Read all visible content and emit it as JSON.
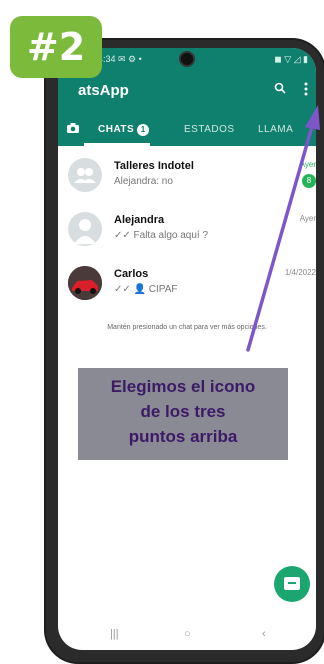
{
  "step_badge": "#2",
  "status_bar": {
    "left": "4:34 ✉ ⚙ •",
    "right": "◼ ▽ ◿ ▮"
  },
  "header": {
    "title": "atsApp",
    "search_icon": "search-icon",
    "menu_icon": "more-vert-icon"
  },
  "tabs": {
    "chats_label": "CHATS",
    "chats_count": "1",
    "estados_label": "ESTADOS",
    "llamadas_label": "LLAMA"
  },
  "chats": [
    {
      "name": "Talleres Indotel",
      "message": "Alejandra: no",
      "time": "Ayer",
      "unread": "8"
    },
    {
      "name": "Alejandra",
      "message": "✓✓ Falta algo aquí ?",
      "time": "Ayer"
    },
    {
      "name": "Carlos",
      "message": "✓✓ 👤 CIPAF",
      "time": "1/4/2022"
    }
  ],
  "hint": "Mantén presionado un chat para ver más opciones.",
  "callout": {
    "line1": "Elegimos el icono",
    "line2": "de los tres",
    "line3": "puntos arriba"
  },
  "navbar": {
    "recent": "|||",
    "home": "○",
    "back": "‹"
  },
  "colors": {
    "header": "#0f7f6e",
    "badge": "#7cba3b",
    "arrow": "#7d57c9",
    "callout_bg": "#8a8a94",
    "callout_text": "#3c1a66",
    "unread": "#25b35a"
  }
}
